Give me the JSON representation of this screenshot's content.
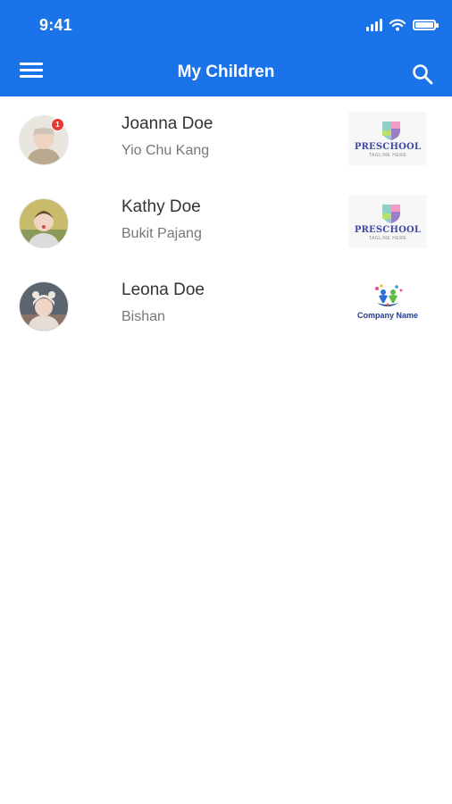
{
  "status_bar": {
    "time": "9:41",
    "icons": [
      "signal-icon",
      "wifi-icon",
      "battery-icon"
    ]
  },
  "app_bar": {
    "title": "My Children",
    "menu_icon": "hamburger-menu-icon",
    "search_icon": "search-icon",
    "background": "#1a73e8"
  },
  "children": [
    {
      "name": "Joanna Doe",
      "location": "Yio Chu Kang",
      "badge": "1",
      "school_logo": "preschool-logo",
      "logo_text": "PRESCHOOL",
      "logo_subtext": "TAGLINE HERE"
    },
    {
      "name": "Kathy Doe",
      "location": "Bukit Pajang",
      "school_logo": "preschool-logo",
      "logo_text": "PRESCHOOL",
      "logo_subtext": "TAGLINE HERE"
    },
    {
      "name": "Leona Doe",
      "location": "Bishan",
      "school_logo": "company-logo",
      "logo_text": "Company Name"
    }
  ]
}
